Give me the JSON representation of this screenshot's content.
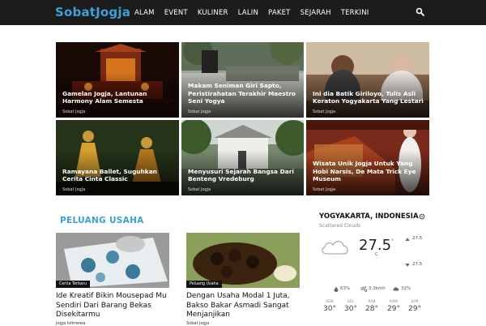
{
  "site": {
    "logo": "SobatJogja"
  },
  "nav": {
    "items": [
      "ALAM",
      "EVENT",
      "KULINER",
      "LALIN",
      "PAKET",
      "SEJARAH",
      "TERKINI"
    ]
  },
  "grid": [
    {
      "title": "Gamelan Jogja, Lantunan Harmony Alam Semesta",
      "author": "Sobat Jogja"
    },
    {
      "title": "Makam Seniman Giri Sapto, Peristirahatan Terakhir Maestro Seni Yogya",
      "author": "Sobat Jogja"
    },
    {
      "title": "Ini dia Batik Giriloyo, Tulis Asli Keraton Yogyakarta Yang Lestari",
      "author": "Sobat Jogja"
    },
    {
      "title": "Ramayana Ballet, Suguhkan Cerita Cinta Classic",
      "author": "Sobat Jogja"
    },
    {
      "title": "Menyusuri Sejarah Bangsa Dari Benteng Vredeburg",
      "author": "Sobat Jogja"
    },
    {
      "title": "Wisata Unik Jogja Untuk Yang Hobi Narsis, De Mata Trick Eye Museum",
      "author": "Sobat Jogja"
    }
  ],
  "section": {
    "title": "PELUANG USAHA"
  },
  "articles": [
    {
      "category": "Cerita Terbaru",
      "title": "Ide Kreatif Bikin Mousepad Mu Sendiri Dari Barang Bekas Disekitarmu",
      "author": "Jogja Istimewa"
    },
    {
      "category": "Peluang Usaha",
      "title": "Dengan Usaha Modal 1 Juta, Bakso Bakar Asmadi Sangat Menjanjikan",
      "author": "Sobat Jogja"
    }
  ],
  "weather": {
    "location": "YOGYAKARTA, INDONESIA",
    "condition": "Scattered Clouds",
    "temp": "27.5",
    "degree": "°",
    "unit": "C",
    "high": "27.5",
    "low": "27.5",
    "humidity": "63%",
    "wind": "3.3kmh",
    "clouds": "32%",
    "days": [
      {
        "day": "SEN",
        "temp": "30°"
      },
      {
        "day": "SEL",
        "temp": "30°"
      },
      {
        "day": "RAB",
        "temp": "28°"
      },
      {
        "day": "KAM",
        "temp": "29°"
      },
      {
        "day": "JUM",
        "temp": "29°"
      }
    ]
  },
  "colors": {
    "accent": "#3aa1d6",
    "topbar": "#1c1c1c"
  }
}
